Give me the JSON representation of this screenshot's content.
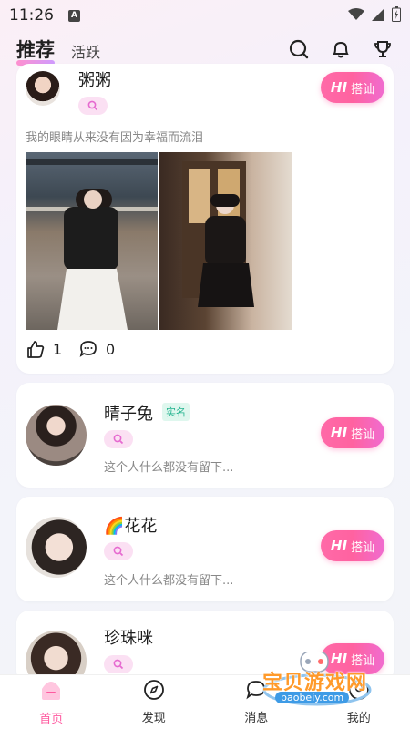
{
  "status_bar": {
    "time": "11:26",
    "notification_glyph": "A"
  },
  "header": {
    "tabs": [
      {
        "label": "推荐",
        "active": true
      },
      {
        "label": "活跃",
        "active": false
      }
    ],
    "icons": [
      "search-icon",
      "bell-icon",
      "trophy-icon"
    ]
  },
  "cards": [
    {
      "name": "粥粥",
      "signature": "我的眼睛从来没有因为幸福而流泪",
      "hi_label": "搭讪",
      "likes": "1",
      "comments": "0"
    },
    {
      "name": "晴子兔",
      "verified_label": "实名",
      "signature": "这个人什么都没有留下...",
      "hi_label": "搭讪"
    },
    {
      "name": "🌈花花",
      "signature": "这个人什么都没有留下...",
      "hi_label": "搭讪"
    },
    {
      "name": "珍珠咪",
      "hi_label": "搭讪"
    }
  ],
  "hi_text": "HI",
  "bottom_nav": [
    {
      "label": "首页",
      "active": true
    },
    {
      "label": "发现",
      "active": false
    },
    {
      "label": "消息",
      "active": false
    },
    {
      "label": "我的",
      "active": false
    }
  ],
  "watermark": {
    "text": "宝贝游戏网",
    "url": "baobeiy.com"
  },
  "colors": {
    "accent": "#ff5aa0",
    "verified": "#23b38f",
    "pill": "#fbe0f3"
  }
}
